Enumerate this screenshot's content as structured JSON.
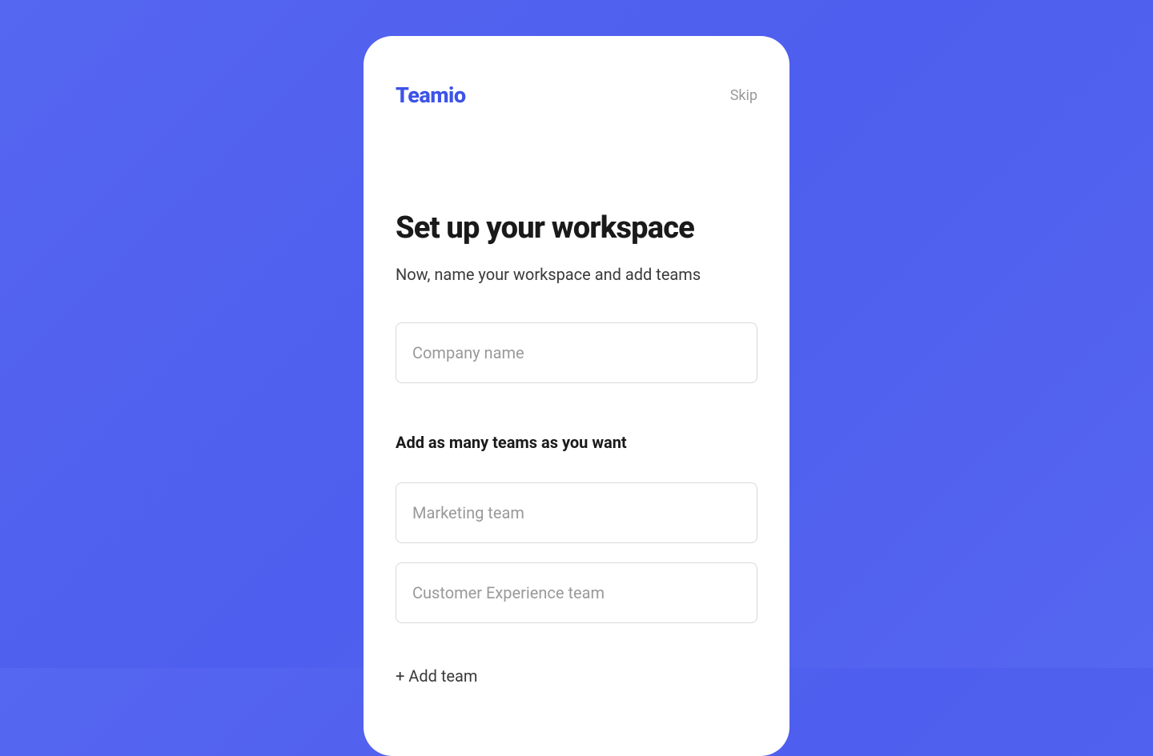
{
  "brand": {
    "name": "Teamio"
  },
  "header": {
    "skip_label": "Skip"
  },
  "main": {
    "heading": "Set up your workspace",
    "subheading": "Now, name your workspace and add teams",
    "company_input": {
      "placeholder": "Company name",
      "value": ""
    },
    "teams_section_label": "Add as many teams as you want",
    "team_inputs": [
      {
        "placeholder": "Marketing team",
        "value": ""
      },
      {
        "placeholder": "Customer Experience team",
        "value": ""
      }
    ],
    "add_team_label": "+ Add team"
  },
  "colors": {
    "brand": "#3d53e8",
    "background": "#5566f0"
  }
}
